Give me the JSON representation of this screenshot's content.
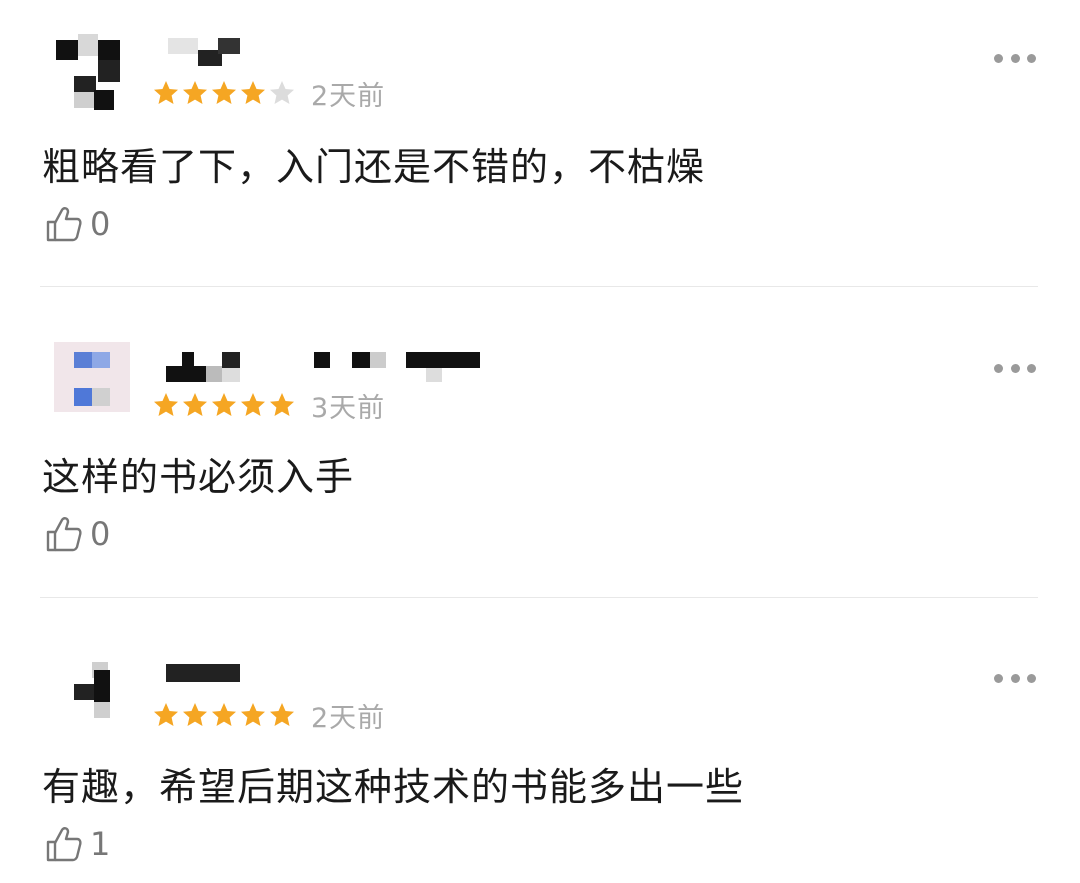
{
  "colors": {
    "star_filled": "#f5a623",
    "star_empty": "#dcdcdc",
    "time_text": "#a9a9a9",
    "comment_text": "#1a1a1a",
    "like_icon": "#777777"
  },
  "reviews": [
    {
      "rating": 4,
      "max_rating": 5,
      "time": "2天前",
      "text": "粗略看了下，入门还是不错的，不枯燥",
      "likes": "0"
    },
    {
      "rating": 5,
      "max_rating": 5,
      "time": "3天前",
      "text": "这样的书必须入手",
      "likes": "0"
    },
    {
      "rating": 5,
      "max_rating": 5,
      "time": "2天前",
      "text": "有趣，希望后期这种技术的书能多出一些",
      "likes": "1"
    }
  ]
}
